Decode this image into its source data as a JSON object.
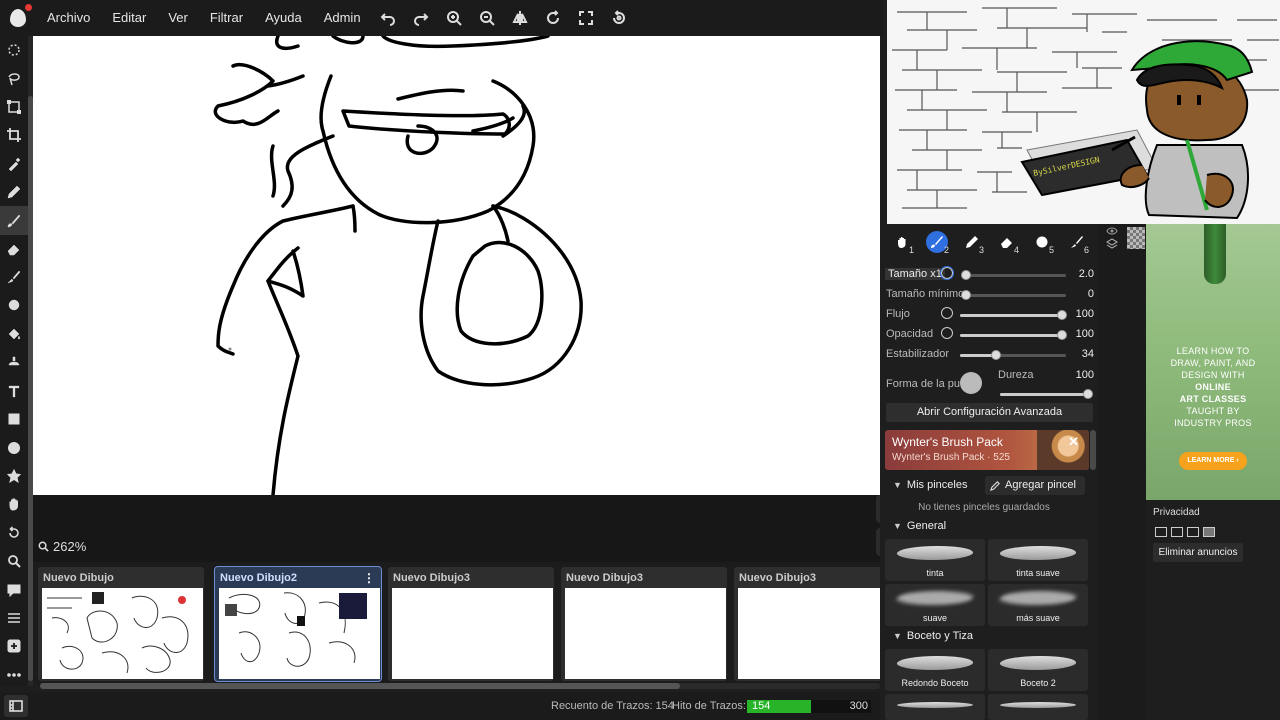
{
  "menubar": {
    "items": [
      "Archivo",
      "Editar",
      "Ver",
      "Filtrar",
      "Ayuda",
      "Admin"
    ]
  },
  "canvas": {
    "zoom": "262%"
  },
  "drawings": [
    {
      "name": "Nuevo Dibujo"
    },
    {
      "name": "Nuevo Dibujo2"
    },
    {
      "name": "Nuevo Dibujo3"
    },
    {
      "name": "Nuevo Dibujo3"
    },
    {
      "name": "Nuevo Dibujo3"
    }
  ],
  "status": {
    "stroke_count_label": "Recuento de Trazos: 154",
    "stroke_goal_label": "Hito de Trazos:",
    "stroke_value": "154",
    "stroke_max": "300",
    "stroke_progress": 0.513
  },
  "brush_tabs": [
    "1",
    "2",
    "3",
    "4",
    "5",
    "6"
  ],
  "settings": {
    "size_label": "Tamaño x1",
    "size_value": "2.0",
    "min_size_label": "Tamaño mínimo",
    "min_size_value": "0",
    "flow_label": "Flujo",
    "flow_value": "100",
    "opacity_label": "Opacidad",
    "opacity_value": "100",
    "stabilizer_label": "Estabilizador",
    "stabilizer_value": "34",
    "tip_label": "Forma de la pu",
    "hardness_label": "Dureza",
    "hardness_value": "100",
    "advanced_button": "Abrir Configuración Avanzada"
  },
  "promo": {
    "title": "Wynter's Brush Pack",
    "subtitle": "Wynter's Brush Pack · 525",
    "close": "✕"
  },
  "brushes": {
    "my_brushes": "Mis pinceles",
    "add_brush": "Agregar pincel",
    "empty": "No tienes pinceles guardados",
    "general": "General",
    "general_items": [
      "tinta",
      "tinta suave",
      "suave",
      "más suave"
    ],
    "sketch": "Boceto y Tiza",
    "sketch_items": [
      "Redondo Boceto",
      "Boceto 2"
    ]
  },
  "ad": {
    "line1": "LEARN HOW TO",
    "line2": "DRAW, PAINT, AND",
    "line3": "DESIGN WITH",
    "line4": "ONLINE",
    "line5": "ART CLASSES",
    "line6": "TAUGHT BY",
    "line7": "INDUSTRY PROS",
    "button": "LEARN MORE ›",
    "privacy": "Privacidad",
    "remove_ads": "Eliminar anuncios"
  },
  "colors": {
    "accent": "#2f6fe0",
    "progress": "#28b428"
  }
}
